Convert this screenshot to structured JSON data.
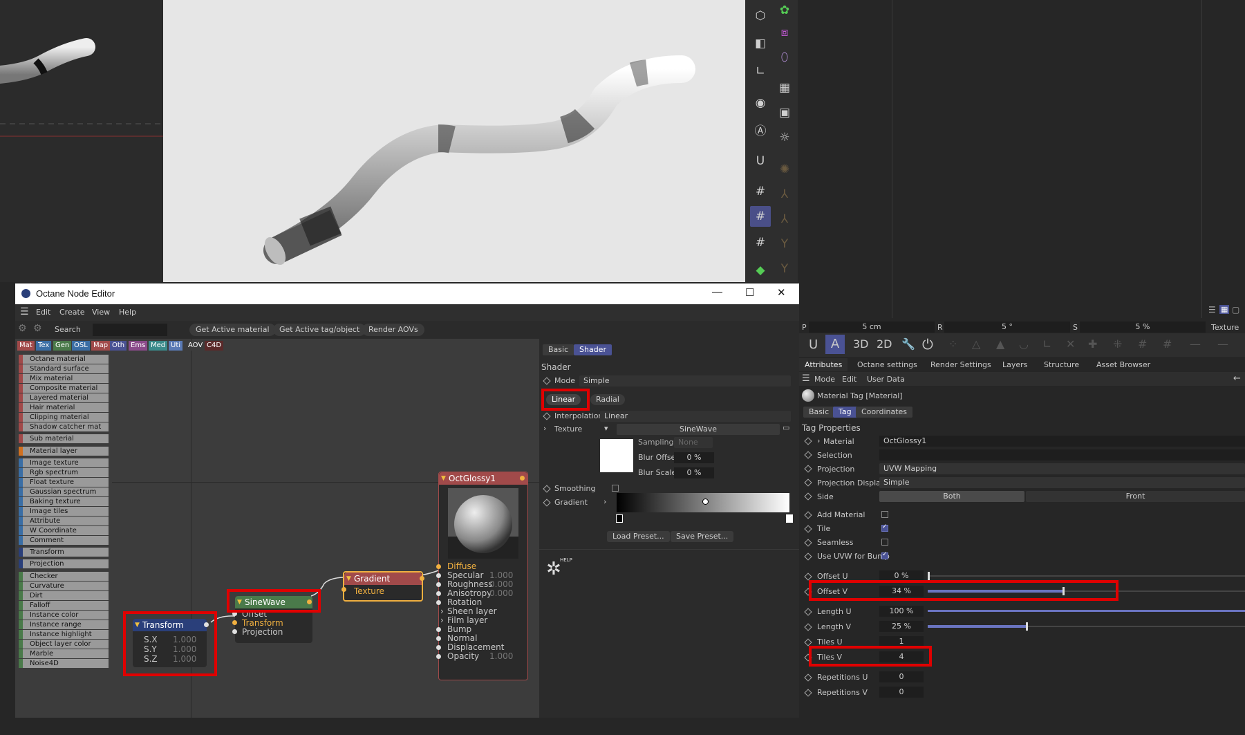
{
  "colors": {
    "accent": "#4a5294",
    "highlight": "#e00000",
    "node_orange": "#f0b040"
  },
  "window": {
    "title": "Octane Node Editor",
    "minimize": "—",
    "maximize": "☐",
    "close": "✕"
  },
  "menu": {
    "items": [
      "Edit",
      "Create",
      "View",
      "Help"
    ]
  },
  "toolbar": {
    "search_label": "Search",
    "search_value": "",
    "get_material": "Get Active material",
    "get_tag": "Get Active tag/object",
    "render_aovs": "Render AOVs"
  },
  "categories": [
    {
      "label": "Mat",
      "color": "#a14a4a"
    },
    {
      "label": "Tex",
      "color": "#3a6ea5"
    },
    {
      "label": "Gen",
      "color": "#4a7a4a"
    },
    {
      "label": "OSL",
      "color": "#3a6ea5"
    },
    {
      "label": "Map",
      "color": "#a14a4a"
    },
    {
      "label": "Oth",
      "color": "#4a5294"
    },
    {
      "label": "Ems",
      "color": "#8a4a8a"
    },
    {
      "label": "Med",
      "color": "#3a8a8a"
    },
    {
      "label": "Uti",
      "color": "#5a7ab5"
    },
    {
      "label": "AOV",
      "color": "#3c3c3c"
    },
    {
      "label": "C4D",
      "color": "#5a2a2a"
    }
  ],
  "sidebar": [
    {
      "label": "Octane material",
      "color": "#a14a4a"
    },
    {
      "label": "Standard surface",
      "color": "#a14a4a"
    },
    {
      "label": "Mix material",
      "color": "#a14a4a"
    },
    {
      "label": "Composite material",
      "color": "#a14a4a"
    },
    {
      "label": "Layered material",
      "color": "#a14a4a"
    },
    {
      "label": "Hair material",
      "color": "#a14a4a"
    },
    {
      "label": "Clipping material",
      "color": "#a14a4a"
    },
    {
      "label": "Shadow catcher mat",
      "color": "#a14a4a"
    },
    {
      "label": "Sub material",
      "color": "#a14a4a"
    },
    {
      "label": "Material layer",
      "color": "#d07020"
    },
    {
      "label": "Image texture",
      "color": "#3a6ea5"
    },
    {
      "label": "Rgb spectrum",
      "color": "#3a6ea5"
    },
    {
      "label": "Float texture",
      "color": "#3a6ea5"
    },
    {
      "label": "Gaussian spectrum",
      "color": "#3a6ea5"
    },
    {
      "label": "Baking texture",
      "color": "#3a6ea5"
    },
    {
      "label": "Image tiles",
      "color": "#3a6ea5"
    },
    {
      "label": "Attribute",
      "color": "#3a6ea5"
    },
    {
      "label": "W Coordinate",
      "color": "#3a6ea5"
    },
    {
      "label": "Comment",
      "color": "#3a6ea5"
    },
    {
      "label": "Transform",
      "color": "#2a3f7a"
    },
    {
      "label": "Projection",
      "color": "#2a3f7a"
    },
    {
      "label": "Checker",
      "color": "#4a7a4a"
    },
    {
      "label": "Curvature",
      "color": "#4a7a4a"
    },
    {
      "label": "Dirt",
      "color": "#4a7a4a"
    },
    {
      "label": "Falloff",
      "color": "#4a7a4a"
    },
    {
      "label": "Instance color",
      "color": "#4a7a4a"
    },
    {
      "label": "Instance range",
      "color": "#4a7a4a"
    },
    {
      "label": "Instance highlight",
      "color": "#4a7a4a"
    },
    {
      "label": "Object layer color",
      "color": "#4a7a4a"
    },
    {
      "label": "Marble",
      "color": "#4a7a4a"
    },
    {
      "label": "Noise4D",
      "color": "#4a7a4a"
    }
  ],
  "nodes": {
    "transform": {
      "title": "Transform",
      "rows": [
        {
          "k": "S.X",
          "v": "1.000"
        },
        {
          "k": "S.Y",
          "v": "1.000"
        },
        {
          "k": "S.Z",
          "v": "1.000"
        }
      ]
    },
    "sinewave": {
      "title": "SineWave",
      "inputs": [
        "Offset",
        "Transform",
        "Projection"
      ]
    },
    "gradient": {
      "title": "Gradient",
      "inputs": [
        "Texture"
      ]
    },
    "octglossy": {
      "title": "OctGlossy1",
      "inputs": [
        {
          "k": "Diffuse",
          "v": ""
        },
        {
          "k": "Specular",
          "v": "1.000"
        },
        {
          "k": "Roughness",
          "v": "0.000"
        },
        {
          "k": "Anisotropy",
          "v": "0.000"
        },
        {
          "k": "Rotation",
          "v": ""
        },
        {
          "k": "Sheen layer",
          "v": ""
        },
        {
          "k": "Film layer",
          "v": ""
        },
        {
          "k": "Bump",
          "v": ""
        },
        {
          "k": "Normal",
          "v": ""
        },
        {
          "k": "Displacement",
          "v": ""
        },
        {
          "k": "Opacity",
          "v": "1.000"
        }
      ]
    }
  },
  "shader": {
    "tabs": [
      "Basic",
      "Shader"
    ],
    "heading": "Shader",
    "mode_label": "Mode",
    "mode_value": "Simple",
    "linear": "Linear",
    "radial": "Radial",
    "interp_label": "Interpolation",
    "interp_value": "Linear",
    "texture_label": "Texture",
    "texture_value": "SineWave",
    "sampling_label": "Sampling",
    "sampling_value": "None",
    "blur_offset_label": "Blur Offset",
    "blur_offset_value": "0 %",
    "blur_scale_label": "Blur Scale",
    "blur_scale_value": "0 %",
    "smoothing_label": "Smoothing",
    "gradient_label": "Gradient",
    "load_preset": "Load Preset...",
    "save_preset": "Save Preset...",
    "help": "HELP"
  },
  "coord": {
    "p_label": "P",
    "p_value": "5 cm",
    "r_label": "R",
    "r_value": "5 °",
    "s_label": "S",
    "s_value": "5 %",
    "texture": "Texture"
  },
  "attr": {
    "tabs": [
      "Attributes",
      "Octane settings",
      "Render Settings",
      "Layers",
      "Structure",
      "Asset Browser"
    ],
    "sub": [
      "Mode",
      "Edit",
      "User Data"
    ],
    "object": "Material Tag [Material]",
    "subtabs": [
      "Basic",
      "Tag",
      "Coordinates"
    ],
    "section": "Tag Properties",
    "material_label": "Material",
    "material_value": "OctGlossy1",
    "selection_label": "Selection",
    "projection_label": "Projection",
    "projection_value": "UVW Mapping",
    "projdisp_label": "Projection Display",
    "projdisp_value": "Simple",
    "side_label": "Side",
    "side_both": "Both",
    "side_front": "Front",
    "add_material": "Add Material",
    "tile": "Tile",
    "seamless": "Seamless",
    "use_uvw": "Use UVW for Bump",
    "offset_u_label": "Offset U",
    "offset_u_value": "0 %",
    "offset_v_label": "Offset V",
    "offset_v_value": "34 %",
    "length_u_label": "Length U",
    "length_u_value": "100 %",
    "length_v_label": "Length V",
    "length_v_value": "25 %",
    "tiles_u_label": "Tiles U",
    "tiles_u_value": "1",
    "tiles_v_label": "Tiles V",
    "tiles_v_value": "4",
    "rep_u_label": "Repetitions U",
    "rep_u_value": "0",
    "rep_v_label": "Repetitions V",
    "rep_v_value": "0"
  }
}
